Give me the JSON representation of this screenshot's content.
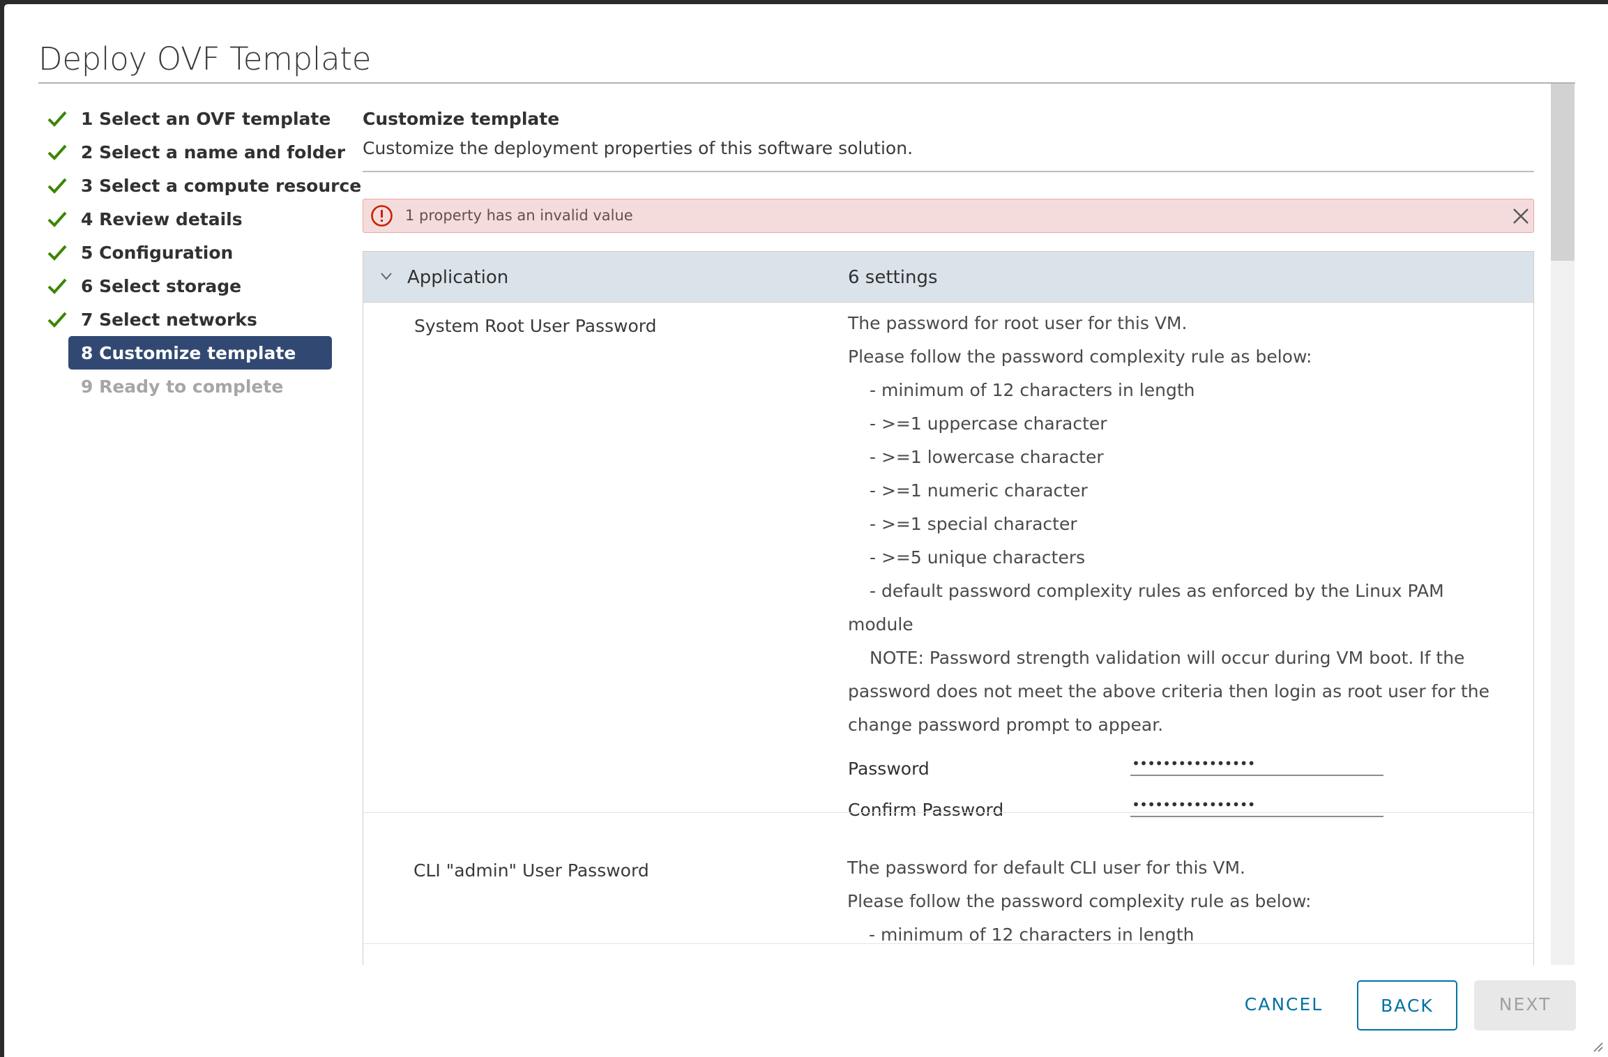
{
  "dialog": {
    "title": "Deploy OVF Template"
  },
  "steps": [
    {
      "label": "1 Select an OVF template",
      "state": "done"
    },
    {
      "label": "2 Select a name and folder",
      "state": "done"
    },
    {
      "label": "3 Select a compute resource",
      "state": "done"
    },
    {
      "label": "4 Review details",
      "state": "done"
    },
    {
      "label": "5 Configuration",
      "state": "done"
    },
    {
      "label": "6 Select storage",
      "state": "done"
    },
    {
      "label": "7 Select networks",
      "state": "done"
    },
    {
      "label": "8 Customize template",
      "state": "active"
    },
    {
      "label": "9 Ready to complete",
      "state": "disabled"
    }
  ],
  "content": {
    "title": "Customize template",
    "subtitle": "Customize the deployment properties of this software solution."
  },
  "alert": {
    "text": "1 property has an invalid value",
    "icon": "error-icon",
    "color": "#c92100"
  },
  "group": {
    "name": "Application",
    "count": "6 settings"
  },
  "properties": [
    {
      "name": "System Root User Password",
      "desc": [
        "The password for root user for this VM.",
        "Please follow the password complexity rule as below:",
        "- minimum of 12 characters in length",
        "- >=1 uppercase character",
        "- >=1 lowercase character",
        "- >=1 numeric character",
        "- >=1 special character",
        "- >=5 unique characters",
        "- default password complexity rules as enforced by the Linux PAM",
        "module",
        "NOTE: Password strength validation will occur during VM boot.  If the",
        "password does not meet the above criteria then login as root user for the",
        "change password prompt to appear."
      ],
      "password_label": "Password",
      "password_value": "••••••••••••••••",
      "confirm_label": "Confirm Password",
      "confirm_value": "••••••••••••••••"
    },
    {
      "name": "CLI \"admin\" User Password",
      "desc": [
        "The password for default CLI user for this VM.",
        "Please follow the password complexity rule as below:",
        "- minimum of 12 characters in length"
      ]
    }
  ],
  "footer": {
    "cancel": "CANCEL",
    "back": "BACK",
    "next": "NEXT"
  },
  "colors": {
    "accent": "#0072a3",
    "active_step": "#314972",
    "check": "#3c8500",
    "header_row": "#dbe3ea"
  }
}
